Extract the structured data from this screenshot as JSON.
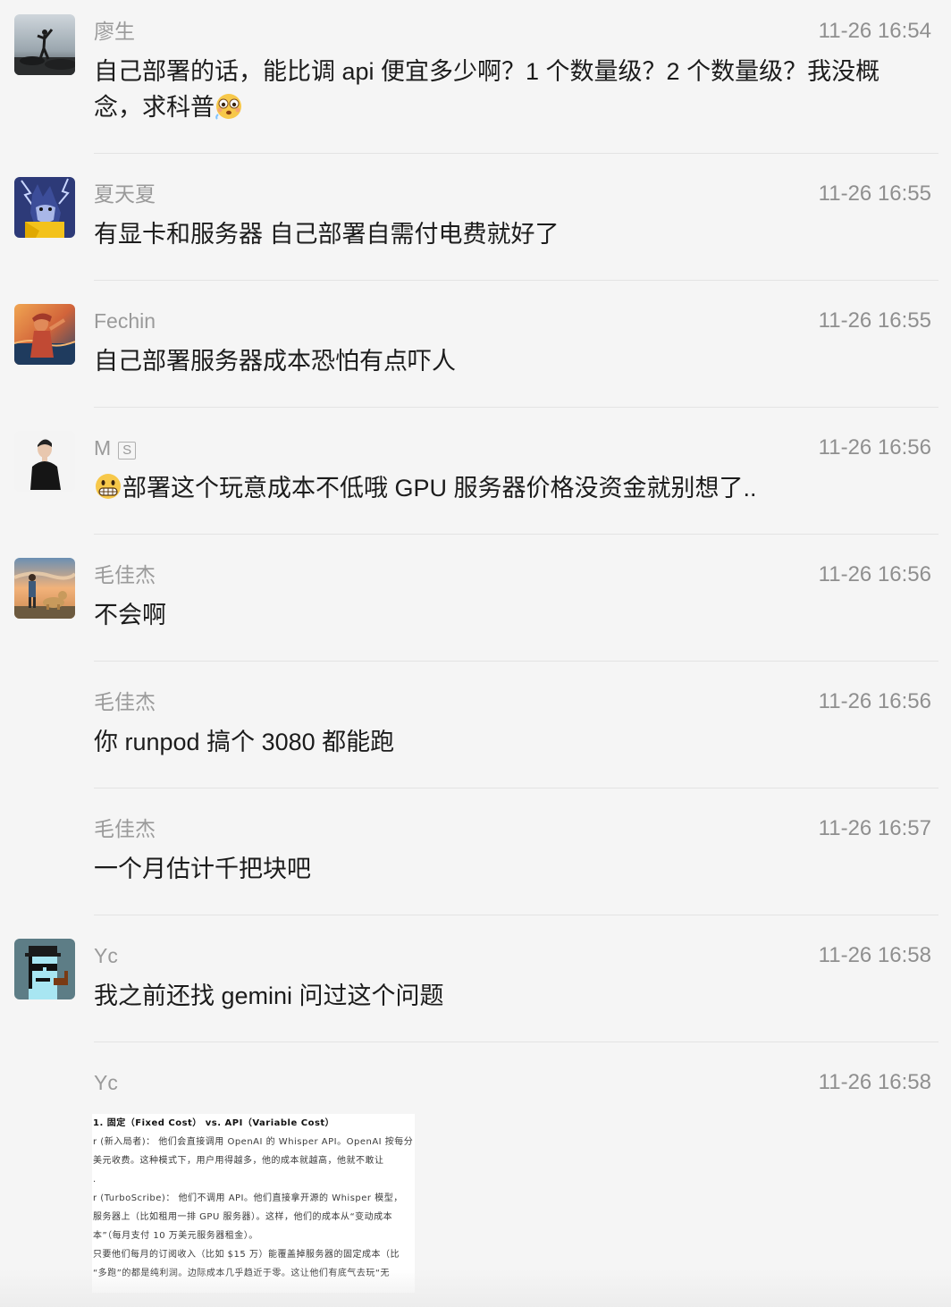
{
  "messages": [
    {
      "name": "廖生",
      "time": "11-26 16:54",
      "text_line1": "自己部署的话，能比调 api 便宜多少啊？1 个数量级？2 个数量级？我没概",
      "text_line2": "念，求科普",
      "avatar_icon": "silhouette-at-shore-avatar",
      "emoji": "woozy-face-emoji"
    },
    {
      "name": "夏天夏",
      "time": "11-26 16:55",
      "text": "有显卡和服务器 自己部署自需付电费就好了",
      "avatar_icon": "cartoon-wolf-lightning-avatar"
    },
    {
      "name": "Fechin",
      "time": "11-26 16:55",
      "text": "自己部署服务器成本恐怕有点吓人",
      "avatar_icon": "sunset-painting-avatar"
    },
    {
      "name": "M",
      "badge": "S",
      "time": "11-26 16:56",
      "text": "部署这个玩意成本不低哦 GPU 服务器价格没资金就别想了..",
      "avatar_icon": "person-silhouette-avatar",
      "emoji": "grimacing-face-emoji"
    },
    {
      "name": "毛佳杰",
      "time": "11-26 16:56",
      "text": "不会啊",
      "avatar_icon": "boy-and-dog-sunset-avatar"
    },
    {
      "name": "毛佳杰",
      "time": "11-26 16:56",
      "text": "你 runpod 搞个 3080 都能跑"
    },
    {
      "name": "毛佳杰",
      "time": "11-26 16:57",
      "text": "一个月估计千把块吧"
    },
    {
      "name": "Yc",
      "time": "11-26 16:58",
      "text": "我之前还找 gemini 问过这个问题",
      "avatar_icon": "pixel-art-character-avatar"
    },
    {
      "name": "Yc",
      "time": "11-26 16:58",
      "image_lines": [
        "1. 固定（Fixed Cost） vs. API（Variable Cost）",
        "r (新入局者)： 他们会直接调用 OpenAI 的 Whisper API。OpenAI 按每分",
        "美元收费。这种模式下，用户用得越多，他的成本就越高，他就不敢让",
        ".",
        "r (TurboScribe)： 他们不调用 API。他们直接拿开源的 Whisper 模型，",
        "服务器上（比如租用一排 GPU 服务器）。这样，他们的成本从“变动成本",
        "本”（每月支付 10 万美元服务器租金）。",
        "只要他们每月的订阅收入（比如 $15 万）能覆盖掉服务器的固定成本（比",
        "“多跑”的都是纯利润。边际成本几乎趋近于零。这让他们有底气去玩“无"
      ]
    }
  ]
}
